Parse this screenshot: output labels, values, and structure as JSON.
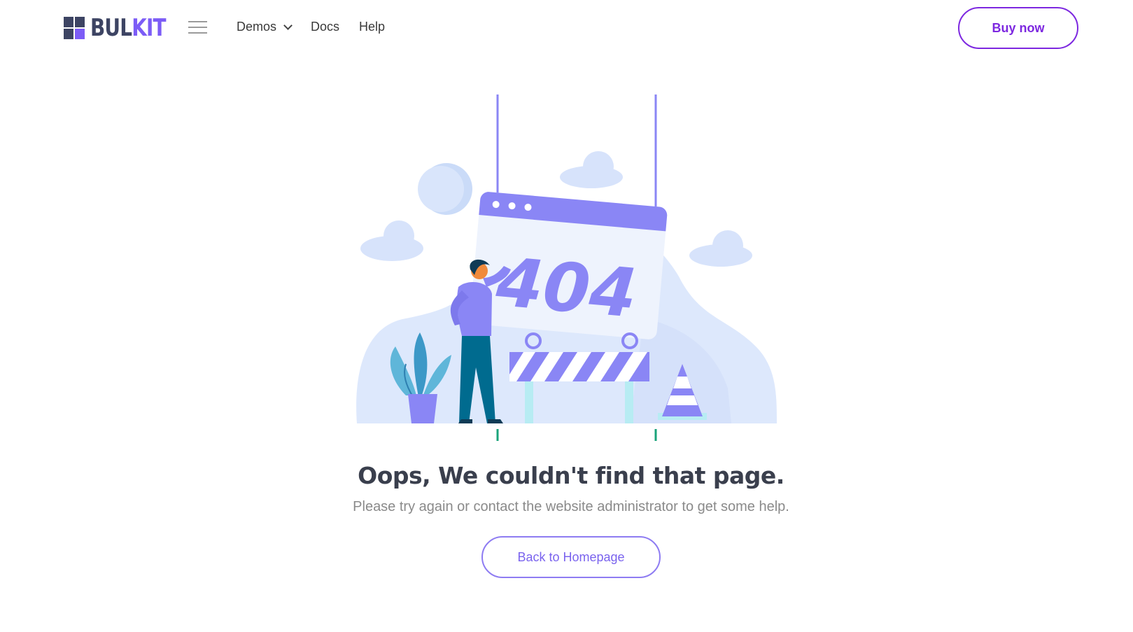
{
  "header": {
    "logo": {
      "text_dark": "BUL",
      "text_accent": "KIT"
    },
    "menu_icon": "hamburger-menu-icon",
    "nav": [
      {
        "label": "Demos",
        "has_dropdown": true
      },
      {
        "label": "Docs"
      },
      {
        "label": "Help"
      }
    ],
    "cta_label": "Buy now"
  },
  "illustration": {
    "sign_text": "404",
    "icons": [
      "cloud-icon",
      "moon-icon",
      "barrier-icon",
      "traffic-cone-icon",
      "plant-icon",
      "person-figure"
    ]
  },
  "main": {
    "heading": "Oops, We couldn't find that page.",
    "subtext": "Please try again or contact the website administrator to get some help.",
    "button_label": "Back to Homepage"
  },
  "colors": {
    "accent_purple": "#7d28e0",
    "illustration_purple": "#8a86f5",
    "light_blue": "#dbe6fb",
    "text_dark": "#3a3f4d",
    "text_muted": "#8a8a8a"
  }
}
